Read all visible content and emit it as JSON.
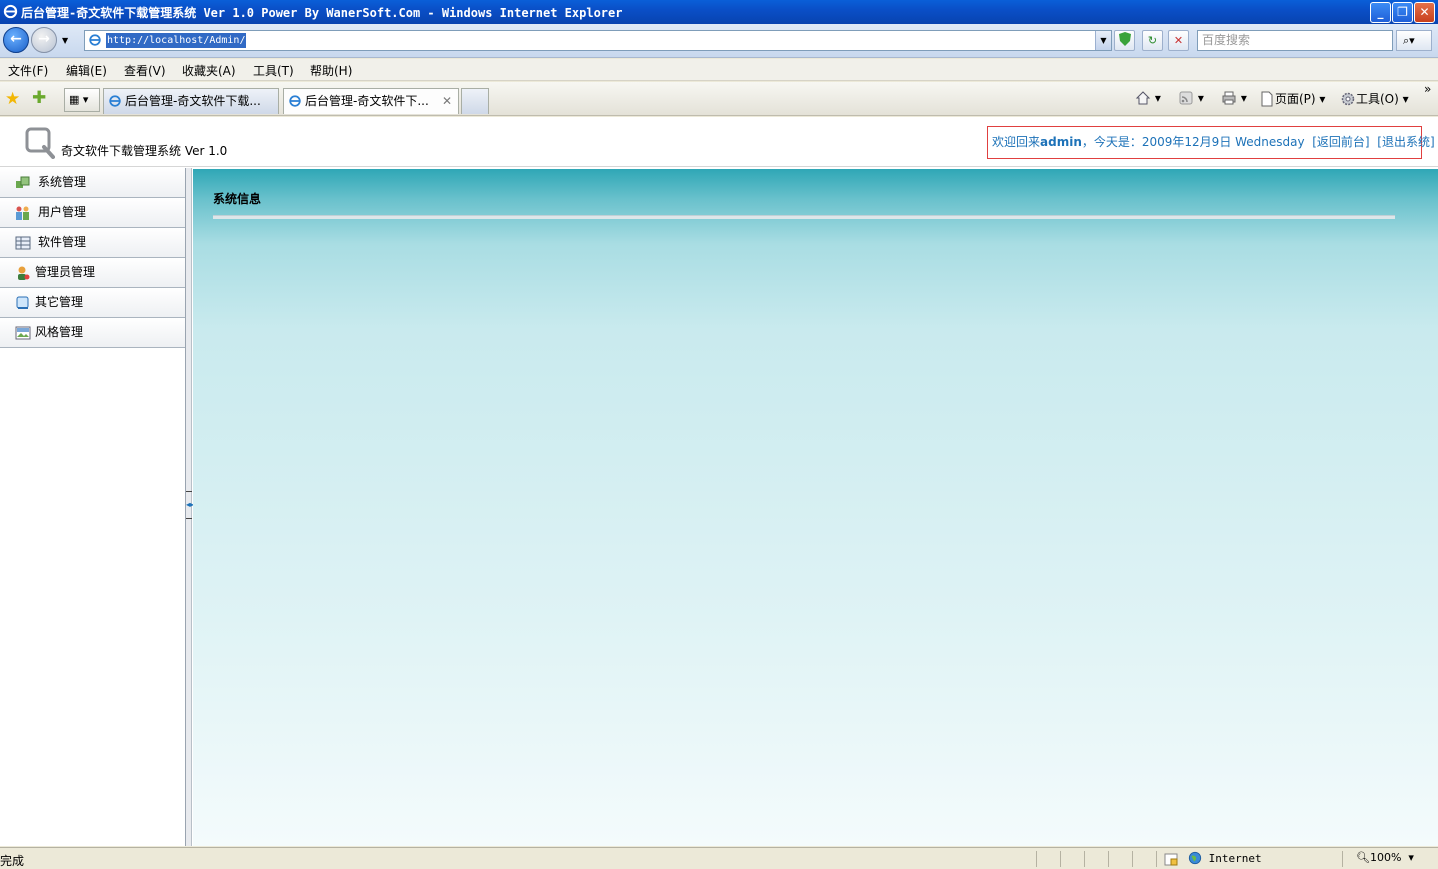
{
  "window": {
    "title": "后台管理-奇文软件下载管理系统 Ver 1.0 Power By WanerSoft.Com - Windows Internet Explorer",
    "minimize_label": "_",
    "maximize_label": "❐",
    "close_label": "✕"
  },
  "address": {
    "back_glyph": "←",
    "forward_glyph": "→",
    "url": "http://localhost/Admin/",
    "search_placeholder": "百度搜索",
    "refresh_glyph": "↻",
    "stop_glyph": "✕",
    "search_glyph": "⌕▾"
  },
  "menu": [
    "文件(F)",
    "编辑(E)",
    "查看(V)",
    "收藏夹(A)",
    "工具(T)",
    "帮助(H)"
  ],
  "tabs": [
    {
      "label": "后台管理-奇文软件下载..."
    },
    {
      "label": "后台管理-奇文软件下..."
    }
  ],
  "tab_close": "✕",
  "commandbar": {
    "page_label": "页面(P)",
    "tools_label": "工具(O)",
    "chevron": "»"
  },
  "site": {
    "title": "奇文软件下载管理系统 Ver 1.0",
    "welcome_prefix": "欢迎回来",
    "username": "admin",
    "date_text": "，今天是：2009年12月9日 Wednesday",
    "front_link": "[返回前台]",
    "logout_link": "[退出系统]"
  },
  "sidebar": [
    {
      "label": "系统管理",
      "icon": "system-icon"
    },
    {
      "label": "用户管理",
      "icon": "users-icon"
    },
    {
      "label": "软件管理",
      "icon": "software-icon"
    },
    {
      "label": "管理员管理",
      "icon": "admin-icon"
    },
    {
      "label": "其它管理",
      "icon": "other-icon"
    },
    {
      "label": "风格管理",
      "icon": "style-icon"
    }
  ],
  "main": {
    "heading": "系统信息"
  },
  "status": {
    "text": "完成",
    "zone": "Internet",
    "zoom": "100%"
  },
  "colors": {
    "titlebar": "#0a4fc7",
    "welcome_border": "#e04040",
    "link": "#1d72b8",
    "main_top": "#2fa7b6"
  }
}
